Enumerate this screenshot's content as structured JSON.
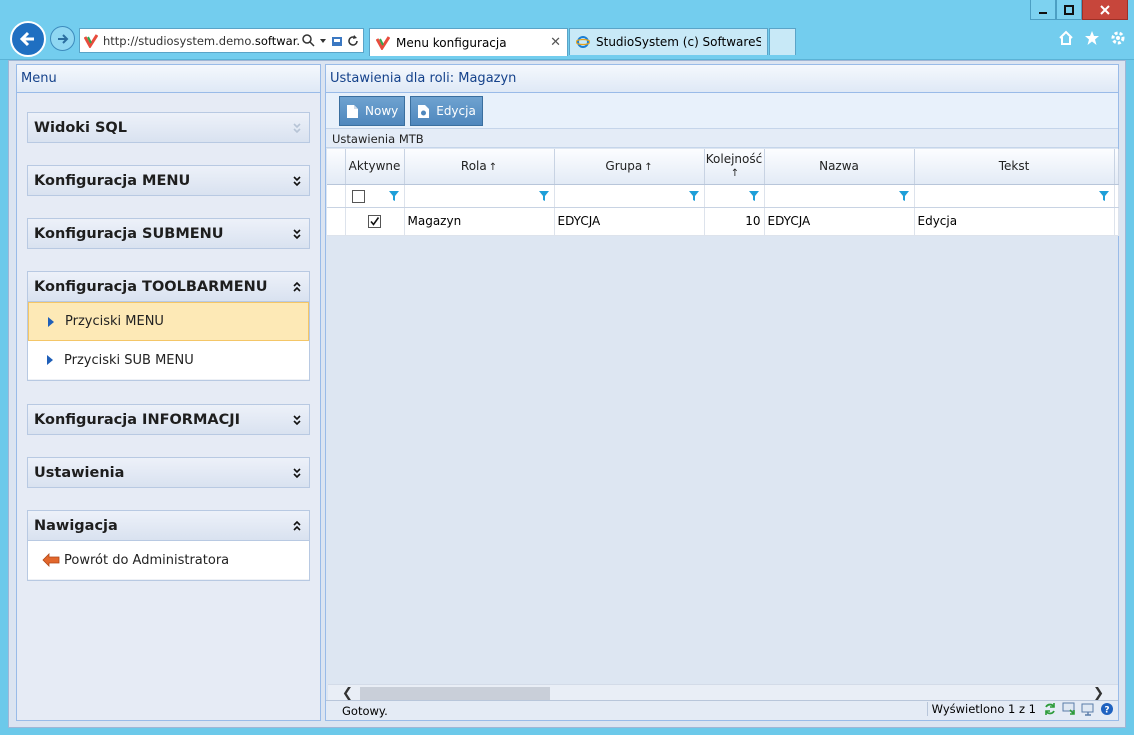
{
  "browser": {
    "address_url_prefix": "http://studiosystem.demo.",
    "address_url_host": "softwar...",
    "tabs": [
      {
        "title": "Menu konfiguracja",
        "active": true
      },
      {
        "title": "StudioSystem (c) SoftwareStud...",
        "active": false
      }
    ]
  },
  "left_panel": {
    "title": "Menu",
    "sections": [
      {
        "label": "Widoki SQL",
        "expanded": false
      },
      {
        "label": "Konfiguracja MENU",
        "expanded": false
      },
      {
        "label": "Konfiguracja SUBMENU",
        "expanded": false
      },
      {
        "label": "Konfiguracja TOOLBARMENU",
        "expanded": true,
        "items": [
          "Przyciski MENU",
          "Przyciski SUB MENU"
        ],
        "selected": "Przyciski MENU"
      },
      {
        "label": "Konfiguracja INFORMACJI",
        "expanded": false
      },
      {
        "label": "Ustawienia",
        "expanded": false
      },
      {
        "label": "Nawigacja",
        "expanded": true,
        "items": [
          "Powrót do Administratora"
        ]
      }
    ]
  },
  "right_panel": {
    "title": "Ustawienia dla roli: Magazyn",
    "toolbar": {
      "new_label": "Nowy",
      "edit_label": "Edycja"
    },
    "grid_caption": "Ustawienia MTB",
    "columns": [
      "Aktywne",
      "Rola",
      "Grupa",
      "Kolejność",
      "Nazwa",
      "Tekst"
    ],
    "rows": [
      {
        "aktywne": true,
        "rola": "Magazyn",
        "grupa": "EDYCJA",
        "kolejnosc": "10",
        "nazwa": "EDYCJA",
        "tekst": "Edycja"
      }
    ],
    "status": "Gotowy.",
    "count_text": "Wyświetlono 1 z 1"
  },
  "colors": {
    "accent": "#15428b",
    "selected": "#fde9b6",
    "button": "#4e87bd"
  }
}
